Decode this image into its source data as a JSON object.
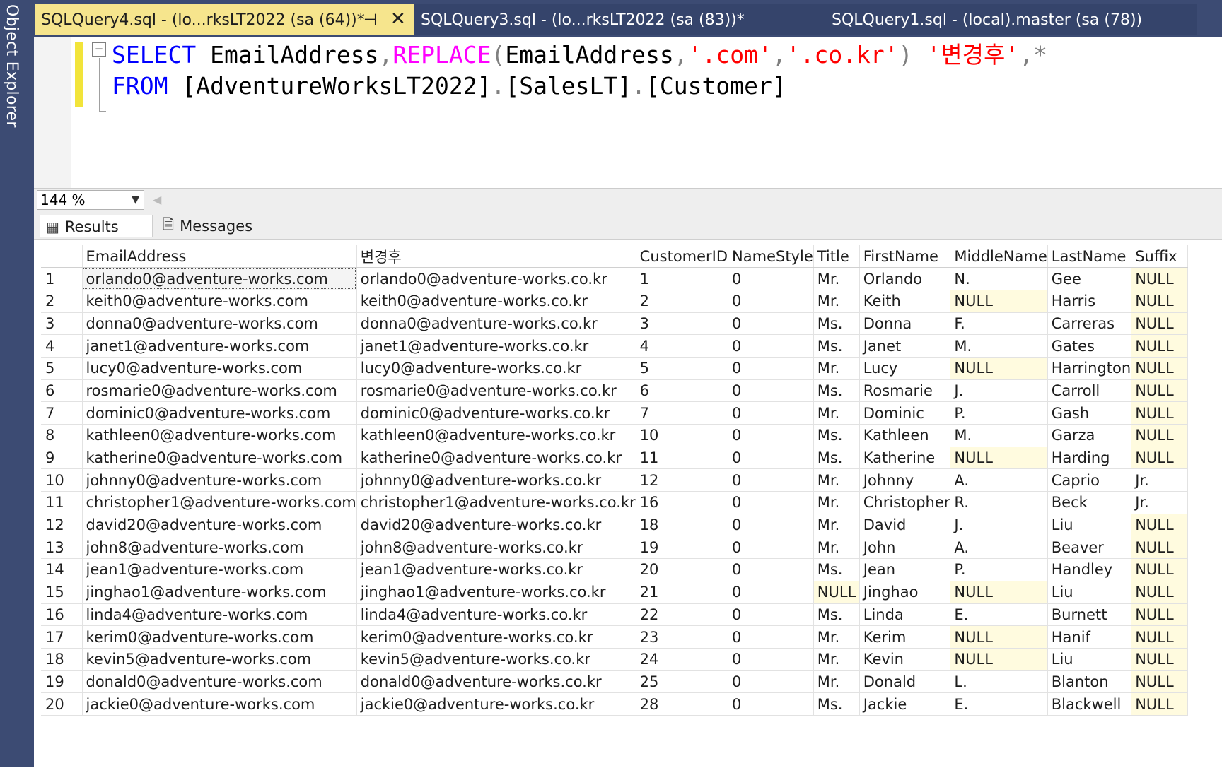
{
  "object_explorer": {
    "label": "Object Explorer"
  },
  "tabs": [
    {
      "title": "SQLQuery4.sql - (lo...rksLT2022 (sa (64))*",
      "active": true
    },
    {
      "title": "SQLQuery3.sql - (lo...rksLT2022 (sa (83))*",
      "active": false
    },
    {
      "title": "SQLQuery1.sql - (local).master (sa (78))",
      "active": false
    }
  ],
  "tab_icons": {
    "pin": "pin-icon",
    "close": "close-icon"
  },
  "editor": {
    "line1": [
      {
        "t": "SELECT",
        "c": "kw"
      },
      {
        "t": " EmailAddress",
        "c": ""
      },
      {
        "t": ",",
        "c": "gray"
      },
      {
        "t": "REPLACE",
        "c": "fn"
      },
      {
        "t": "(",
        "c": "gray"
      },
      {
        "t": "EmailAddress",
        "c": ""
      },
      {
        "t": ",",
        "c": "gray"
      },
      {
        "t": "'.com'",
        "c": "str"
      },
      {
        "t": ",",
        "c": "gray"
      },
      {
        "t": "'.co.kr'",
        "c": "str"
      },
      {
        "t": ")",
        "c": "gray"
      },
      {
        "t": " '변경후'",
        "c": "str"
      },
      {
        "t": ",*",
        "c": "gray"
      }
    ],
    "line2": [
      {
        "t": "FROM",
        "c": "kw"
      },
      {
        "t": " [AdventureWorksLT2022]",
        "c": ""
      },
      {
        "t": ".",
        "c": "gray"
      },
      {
        "t": "[SalesLT]",
        "c": ""
      },
      {
        "t": ".",
        "c": "gray"
      },
      {
        "t": "[Customer]",
        "c": ""
      }
    ]
  },
  "zoom": {
    "value": "144 %"
  },
  "result_tabs": {
    "results": "Results",
    "messages": "Messages"
  },
  "grid": {
    "columns": [
      "",
      "EmailAddress",
      "변경후",
      "CustomerID",
      "NameStyle",
      "Title",
      "FirstName",
      "MiddleName",
      "LastName",
      "Suffix"
    ],
    "rows": [
      [
        "1",
        "orlando0@adventure-works.com",
        "orlando0@adventure-works.co.kr",
        "1",
        "0",
        "Mr.",
        "Orlando",
        "N.",
        "Gee",
        "NULL"
      ],
      [
        "2",
        "keith0@adventure-works.com",
        "keith0@adventure-works.co.kr",
        "2",
        "0",
        "Mr.",
        "Keith",
        "NULL",
        "Harris",
        "NULL"
      ],
      [
        "3",
        "donna0@adventure-works.com",
        "donna0@adventure-works.co.kr",
        "3",
        "0",
        "Ms.",
        "Donna",
        "F.",
        "Carreras",
        "NULL"
      ],
      [
        "4",
        "janet1@adventure-works.com",
        "janet1@adventure-works.co.kr",
        "4",
        "0",
        "Ms.",
        "Janet",
        "M.",
        "Gates",
        "NULL"
      ],
      [
        "5",
        "lucy0@adventure-works.com",
        "lucy0@adventure-works.co.kr",
        "5",
        "0",
        "Mr.",
        "Lucy",
        "NULL",
        "Harrington",
        "NULL"
      ],
      [
        "6",
        "rosmarie0@adventure-works.com",
        "rosmarie0@adventure-works.co.kr",
        "6",
        "0",
        "Ms.",
        "Rosmarie",
        "J.",
        "Carroll",
        "NULL"
      ],
      [
        "7",
        "dominic0@adventure-works.com",
        "dominic0@adventure-works.co.kr",
        "7",
        "0",
        "Mr.",
        "Dominic",
        "P.",
        "Gash",
        "NULL"
      ],
      [
        "8",
        "kathleen0@adventure-works.com",
        "kathleen0@adventure-works.co.kr",
        "10",
        "0",
        "Ms.",
        "Kathleen",
        "M.",
        "Garza",
        "NULL"
      ],
      [
        "9",
        "katherine0@adventure-works.com",
        "katherine0@adventure-works.co.kr",
        "11",
        "0",
        "Ms.",
        "Katherine",
        "NULL",
        "Harding",
        "NULL"
      ],
      [
        "10",
        "johnny0@adventure-works.com",
        "johnny0@adventure-works.co.kr",
        "12",
        "0",
        "Mr.",
        "Johnny",
        "A.",
        "Caprio",
        "Jr."
      ],
      [
        "11",
        "christopher1@adventure-works.com",
        "christopher1@adventure-works.co.kr",
        "16",
        "0",
        "Mr.",
        "Christopher",
        "R.",
        "Beck",
        "Jr."
      ],
      [
        "12",
        "david20@adventure-works.com",
        "david20@adventure-works.co.kr",
        "18",
        "0",
        "Mr.",
        "David",
        "J.",
        "Liu",
        "NULL"
      ],
      [
        "13",
        "john8@adventure-works.com",
        "john8@adventure-works.co.kr",
        "19",
        "0",
        "Mr.",
        "John",
        "A.",
        "Beaver",
        "NULL"
      ],
      [
        "14",
        "jean1@adventure-works.com",
        "jean1@adventure-works.co.kr",
        "20",
        "0",
        "Ms.",
        "Jean",
        "P.",
        "Handley",
        "NULL"
      ],
      [
        "15",
        "jinghao1@adventure-works.com",
        "jinghao1@adventure-works.co.kr",
        "21",
        "0",
        "NULL",
        "Jinghao",
        "NULL",
        "Liu",
        "NULL"
      ],
      [
        "16",
        "linda4@adventure-works.com",
        "linda4@adventure-works.co.kr",
        "22",
        "0",
        "Ms.",
        "Linda",
        "E.",
        "Burnett",
        "NULL"
      ],
      [
        "17",
        "kerim0@adventure-works.com",
        "kerim0@adventure-works.co.kr",
        "23",
        "0",
        "Mr.",
        "Kerim",
        "NULL",
        "Hanif",
        "NULL"
      ],
      [
        "18",
        "kevin5@adventure-works.com",
        "kevin5@adventure-works.co.kr",
        "24",
        "0",
        "Mr.",
        "Kevin",
        "NULL",
        "Liu",
        "NULL"
      ],
      [
        "19",
        "donald0@adventure-works.com",
        "donald0@adventure-works.co.kr",
        "25",
        "0",
        "Mr.",
        "Donald",
        "L.",
        "Blanton",
        "NULL"
      ],
      [
        "20",
        "jackie0@adventure-works.com",
        "jackie0@adventure-works.co.kr",
        "28",
        "0",
        "Ms.",
        "Jackie",
        "E.",
        "Blackwell",
        "NULL"
      ]
    ]
  },
  "colors": {
    "chrome": "#3c4b73",
    "active_tab": "#f6e58d",
    "keyword": "#0000ff",
    "function": "#ff00ff",
    "string": "#ff0000",
    "null_cell": "#fffbdf"
  }
}
